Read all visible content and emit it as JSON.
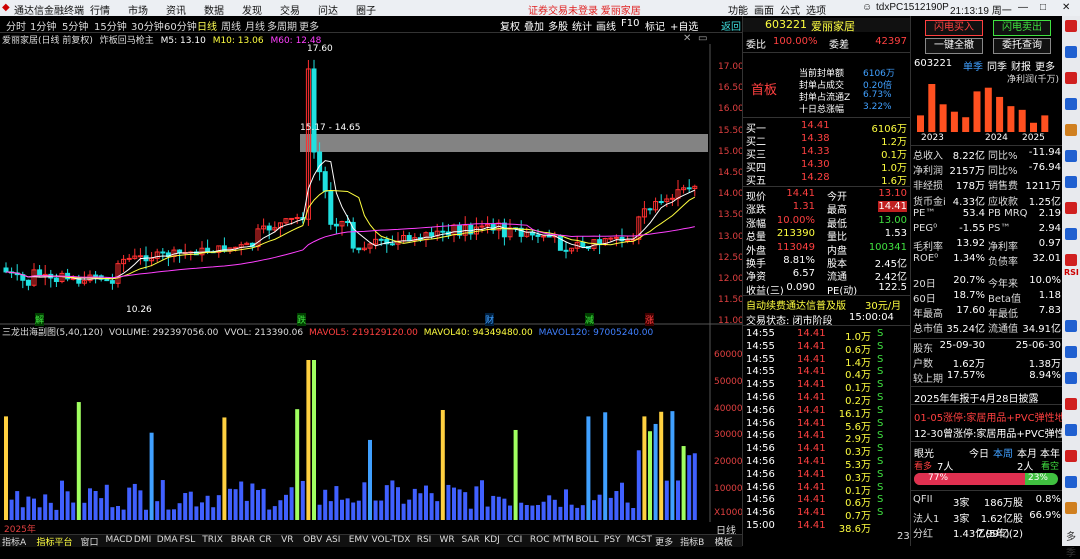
{
  "menubar": {
    "logo": "通达信金融终端",
    "items": [
      "行情",
      "市场",
      "资讯",
      "数据",
      "发现",
      "交易",
      "问达",
      "圈子"
    ],
    "alert": "证券交易未登录  爱丽家居",
    "right_items": [
      "功能",
      "画面",
      "公式",
      "选项"
    ],
    "account": "tdxPC1512190P",
    "clock": "21:13:19 周一"
  },
  "toolbar": {
    "periods": [
      "分时",
      "1分钟",
      "5分钟",
      "15分钟",
      "30分钟",
      "60分钟",
      "日线",
      "周线",
      "月线",
      "多周期",
      "更多"
    ],
    "active_period": "日线",
    "buttons": [
      "复权",
      "叠加",
      "多股",
      "统计",
      "画线",
      "F10",
      "标记",
      "+自选",
      "返回"
    ]
  },
  "chart": {
    "title": "爱丽家居(日线 前复权)",
    "tag": "炸板回马枪主",
    "ma": [
      {
        "label": "M5: 13.10",
        "color": "#ffffff"
      },
      {
        "label": "M10: 13.06",
        "color": "#ffff40"
      },
      {
        "label": "M60: 12.48",
        "color": "#ff40ff"
      }
    ],
    "price_ticks": [
      "17.00",
      "16.50",
      "16.00",
      "15.50",
      "15.00",
      "14.50",
      "14.00",
      "13.50",
      "13.00",
      "12.50",
      "12.00",
      "11.50",
      "11.00"
    ],
    "high_label": "17.60",
    "low_label": "10.26",
    "gap_label": "15.17 - 14.65",
    "markers": [
      {
        "text": "解",
        "color": "#40e040"
      },
      {
        "text": "跌",
        "color": "#40e040"
      },
      {
        "text": "财",
        "color": "#40a0ff"
      },
      {
        "text": "减",
        "color": "#40e040"
      },
      {
        "text": "涨",
        "color": "#ff4040"
      }
    ],
    "vol_title": "三龙出海副图(5,40,120)",
    "vol_items": [
      {
        "label": "VOLUME: 292397056.00",
        "color": "#dddddd"
      },
      {
        "label": "VVOL: 213390.06",
        "color": "#dddddd"
      },
      {
        "label": "MAVOL5: 219129120.00",
        "color": "#ff4040"
      },
      {
        "label": "MAVOL40: 94349480.00",
        "color": "#ffff40"
      },
      {
        "label": "MAVOL120: 97005240.00",
        "color": "#4080ff"
      }
    ],
    "vol_ticks": [
      "60000",
      "50000",
      "40000",
      "30000",
      "20000",
      "10000"
    ],
    "vol_unit": "X10000",
    "date_label": "2025年",
    "period_label": "日线"
  },
  "bottombar": {
    "tabs": [
      "指标A",
      "指标平台",
      "窗口",
      "MACD",
      "DMI",
      "DMA",
      "FSL",
      "TRIX",
      "BRAR",
      "CR",
      "VR",
      "OBV",
      "ASI",
      "EMV",
      "VOL-TDX",
      "RSI",
      "WR",
      "SAR",
      "KDJ",
      "CCI",
      "ROC",
      "MTM",
      "BOLL",
      "PSY",
      "MCST",
      "更多",
      "指标B",
      "模板"
    ]
  },
  "quote": {
    "code": "603221",
    "name": "爱丽家居",
    "weibi_label": "委比",
    "weibi": "100.00%",
    "weicha_label": "委差",
    "weicha": "42397",
    "board": "首板",
    "info": [
      {
        "k": "当前封单额",
        "v": "6106万"
      },
      {
        "k": "封单占成交",
        "v": "0.20倍"
      },
      {
        "k": "封单占流通Z",
        "v": "6.73%"
      },
      {
        "k": "十日总涨幅",
        "v": "3.22%"
      }
    ],
    "sells": [
      "卖五",
      "卖四",
      "卖三",
      "卖二",
      "卖一"
    ],
    "buys": [
      {
        "k": "买一",
        "p": "14.41",
        "v": "6106万"
      },
      {
        "k": "买二",
        "p": "14.38",
        "v": "1.2万"
      },
      {
        "k": "买三",
        "p": "14.33",
        "v": "0.1万"
      },
      {
        "k": "买四",
        "p": "14.30",
        "v": "1.0万"
      },
      {
        "k": "买五",
        "p": "14.28",
        "v": "1.6万"
      }
    ],
    "stats": [
      {
        "k1": "现价",
        "v1": "14.41",
        "k2": "今开",
        "v2": "13.10"
      },
      {
        "k1": "涨跌",
        "v1": "1.31",
        "k2": "最高",
        "v2": "14.41"
      },
      {
        "k1": "涨幅",
        "v1": "10.00%",
        "k2": "最低",
        "v2": "13.00"
      },
      {
        "k1": "总量",
        "v1": "213390",
        "k2": "量比",
        "v2": "1.53"
      },
      {
        "k1": "外盘",
        "v1": "113049",
        "k2": "内盘",
        "v2": "100341"
      },
      {
        "k1": "换手",
        "v1": "8.81%",
        "k2": "股本",
        "v2": "2.45亿"
      },
      {
        "k1": "净资",
        "v1": "6.57",
        "k2": "流通",
        "v2": "2.42亿"
      },
      {
        "k1": "收益(三)",
        "v1": "0.090",
        "k2": "PE(动)",
        "v2": "122.5"
      }
    ],
    "promo": "自动续费通达信普及版",
    "promo_price": "30元/月",
    "status_label": "交易状态: 闭市阶段",
    "status_time": "15:00:04",
    "ticks": [
      {
        "t": "14:55",
        "p": "14.41",
        "v": "1.0万",
        "s": "S"
      },
      {
        "t": "14:55",
        "p": "14.41",
        "v": "0.6万",
        "s": "S"
      },
      {
        "t": "14:55",
        "p": "14.41",
        "v": "1.4万",
        "s": "S"
      },
      {
        "t": "14:55",
        "p": "14.41",
        "v": "0.4万",
        "s": "S"
      },
      {
        "t": "14:55",
        "p": "14.41",
        "v": "0.1万",
        "s": "S"
      },
      {
        "t": "14:56",
        "p": "14.41",
        "v": "0.2万",
        "s": "S"
      },
      {
        "t": "14:56",
        "p": "14.41",
        "v": "16.1万",
        "s": "S"
      },
      {
        "t": "14:56",
        "p": "14.41",
        "v": "5.6万",
        "s": "S"
      },
      {
        "t": "14:56",
        "p": "14.41",
        "v": "2.9万",
        "s": "S"
      },
      {
        "t": "14:56",
        "p": "14.41",
        "v": "0.3万",
        "s": "S"
      },
      {
        "t": "14:56",
        "p": "14.41",
        "v": "5.3万",
        "s": "S"
      },
      {
        "t": "14:56",
        "p": "14.41",
        "v": "0.3万",
        "s": "S"
      },
      {
        "t": "14:56",
        "p": "14.41",
        "v": "0.1万",
        "s": "S"
      },
      {
        "t": "14:56",
        "p": "14.41",
        "v": "0.6万",
        "s": "S"
      },
      {
        "t": "14:56",
        "p": "14.41",
        "v": "0.7万",
        "s": "S"
      },
      {
        "t": "15:00",
        "p": "14.41",
        "v": "38.6万",
        "s": ""
      }
    ],
    "tick_extra": "23"
  },
  "side": {
    "btn_buy": "闪电买入",
    "btn_sell": "闪电卖出",
    "btn_cancel": "一键全撤",
    "btn_query": "委托查询",
    "code": "603221",
    "tabs": [
      "单季",
      "同季",
      "财报",
      "更多"
    ],
    "chart_label": "净利润(千万)",
    "bar_values": [
      0.9,
      2.6,
      1.5,
      1.1,
      0.8,
      2.2,
      2.4,
      1.9,
      1.4,
      1.2,
      0.5,
      0.9
    ],
    "years": [
      "2023",
      "2024",
      "2025"
    ],
    "fin": [
      {
        "k1": "总收入",
        "v1": "8.22亿",
        "k2": "同比%",
        "v2": "-11.94"
      },
      {
        "k1": "净利润",
        "v1": "2157万",
        "k2": "同比%",
        "v2": "-76.94"
      },
      {
        "k1": "非经损",
        "v1": "178万",
        "k2": "销售费",
        "v2": "1211万"
      },
      {
        "k1": "货币金i",
        "v1": "4.33亿",
        "k2": "应收款",
        "v2": "1.25亿"
      },
      {
        "k1": "PE™",
        "v1": "53.4",
        "k2": "PB MRQ",
        "v2": "2.19"
      },
      {
        "k1": "PEG⁰",
        "v1": "-1.55",
        "k2": "PS™",
        "v2": "2.94"
      },
      {
        "k1": "毛利率",
        "v1": "13.92",
        "k2": "净利率",
        "v2": "0.97"
      },
      {
        "k1": "ROE⁰",
        "v1": "1.34%",
        "k2": "负债率",
        "v2": "32.01"
      },
      {
        "k1": "20日",
        "v1": "20.7%",
        "k2": "今年来",
        "v2": "10.0%"
      },
      {
        "k1": "60日",
        "v1": "18.7%",
        "k2": "Beta值",
        "v2": "1.18"
      },
      {
        "k1": "年最高",
        "v1": "17.60",
        "k2": "年最低",
        "v2": "7.83"
      },
      {
        "k1": "总市值",
        "v1": "35.24亿",
        "k2": "流通值",
        "v2": "34.91亿"
      }
    ],
    "holders": [
      {
        "k": "股东",
        "v1": "25-09-30",
        "v2": "25-06-30"
      },
      {
        "k": "户数",
        "v1": "1.62万",
        "v2": "1.38万"
      },
      {
        "k": "较上期",
        "v1": "17.57%",
        "v2": "8.94%"
      }
    ],
    "report": "2025年年报于4月28日披露",
    "news": [
      {
        "text": "01-05涨停:家居用品+PVC弹性地...",
        "color": "#ff4040"
      },
      {
        "text": "12-30曾涨停:家居用品+PVC弹性...",
        "color": "#ffffff"
      }
    ],
    "sentiment": {
      "title": "眼光",
      "tabs": [
        "今日",
        "本周",
        "本月",
        "本年"
      ],
      "bull": "看多",
      "bull_n": "7人",
      "bear_n": "2人",
      "bear": "看空",
      "bull_pct": "77%",
      "bear_pct": "23%",
      "bull_frac": 0.77
    },
    "inst": [
      {
        "k": "QFII",
        "v1": "3家",
        "v2": "186万股",
        "v3": "0.8%"
      },
      {
        "k": "法人1",
        "v1": "3家",
        "v2": "1.62亿股",
        "v3": "66.9%"
      },
      {
        "k": "分红",
        "v1": "1.43亿(5年)",
        "v2": "7.99亿(2)",
        "v3": ""
      }
    ]
  },
  "rightbar": {
    "labels": [
      "RSI",
      "多",
      "季"
    ]
  }
}
